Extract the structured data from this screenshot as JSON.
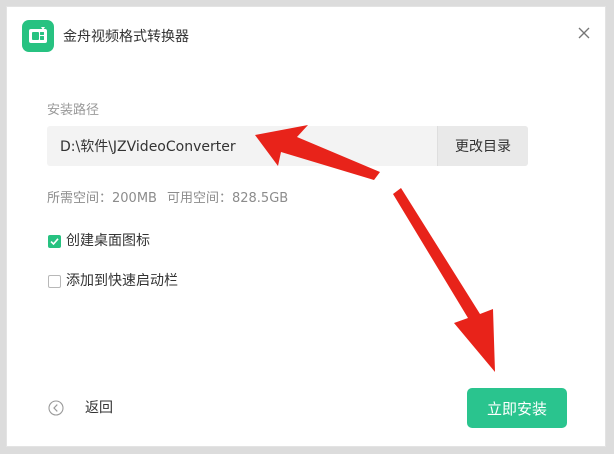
{
  "window": {
    "title": "金舟视频格式转换器",
    "app_icon": "app-logo-icon",
    "close_icon": "close-icon",
    "accent_color": "#27c281"
  },
  "install": {
    "path_label": "安装路径",
    "path_value": "D:\\软件\\JZVideoConverter",
    "change_dir_label": "更改目录",
    "required_space_label": "所需空间：",
    "required_space_value": "200MB",
    "available_space_label": "可用空间：",
    "available_space_value": "828.5GB"
  },
  "options": [
    {
      "label": "创建桌面图标",
      "checked": true
    },
    {
      "label": "添加到快速启动栏",
      "checked": false
    }
  ],
  "footer": {
    "back_label": "返回",
    "back_icon": "arrow-left-circle-icon",
    "install_label": "立即安装",
    "install_color": "#2ac48e"
  },
  "annotations": {
    "arrow_color": "#e8231a",
    "arrow_icon": "red-arrow-annotation"
  }
}
